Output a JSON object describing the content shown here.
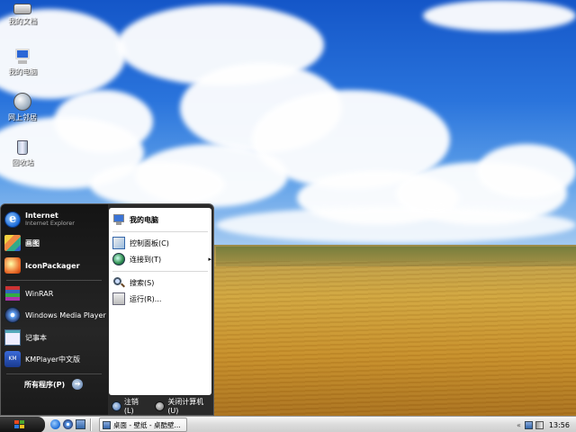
{
  "desktop": {
    "icons": [
      {
        "label": "我的文档",
        "icon": "my-documents-icon"
      },
      {
        "label": "我的电脑",
        "icon": "my-computer-icon"
      },
      {
        "label": "网上邻居",
        "icon": "network-places-icon"
      },
      {
        "label": "回收站",
        "icon": "recycle-bin-icon"
      }
    ]
  },
  "start_menu": {
    "pinned": [
      {
        "label": "Internet",
        "sublabel": "Internet Explorer",
        "icon": "internet-explorer-icon"
      },
      {
        "label": "画图",
        "icon": "paint-icon"
      },
      {
        "label": "IconPackager",
        "icon": "iconpackager-icon"
      }
    ],
    "recent": [
      {
        "label": "WinRAR",
        "icon": "winrar-icon"
      },
      {
        "label": "Windows Media Player",
        "icon": "windows-media-player-icon"
      },
      {
        "label": "记事本",
        "icon": "notepad-icon"
      },
      {
        "label": "KMPlayer中文版",
        "icon": "kmplayer-icon"
      }
    ],
    "all_programs": "所有程序(P)",
    "right": [
      {
        "label": "我的电脑",
        "icon": "my-computer-icon"
      },
      {
        "label": "控制面板(C)",
        "icon": "control-panel-icon"
      },
      {
        "label": "连接到(T)",
        "icon": "connect-to-icon",
        "arrow": "▸"
      },
      {
        "label": "搜索(S)",
        "icon": "search-icon"
      },
      {
        "label": "运行(R)...",
        "icon": "run-icon"
      }
    ],
    "logoff": "注销(L)",
    "shutdown": "关闭计算机(U)"
  },
  "taskbar": {
    "task_label": "桌面 - 壁纸 - 桌酷壁...",
    "tray_chevron": "«",
    "clock": "13:56"
  },
  "colors": {
    "start_menu_bg": "#2a2a2a",
    "taskbar_bg": "#dcdcdc",
    "sky": "#2a74dc"
  }
}
